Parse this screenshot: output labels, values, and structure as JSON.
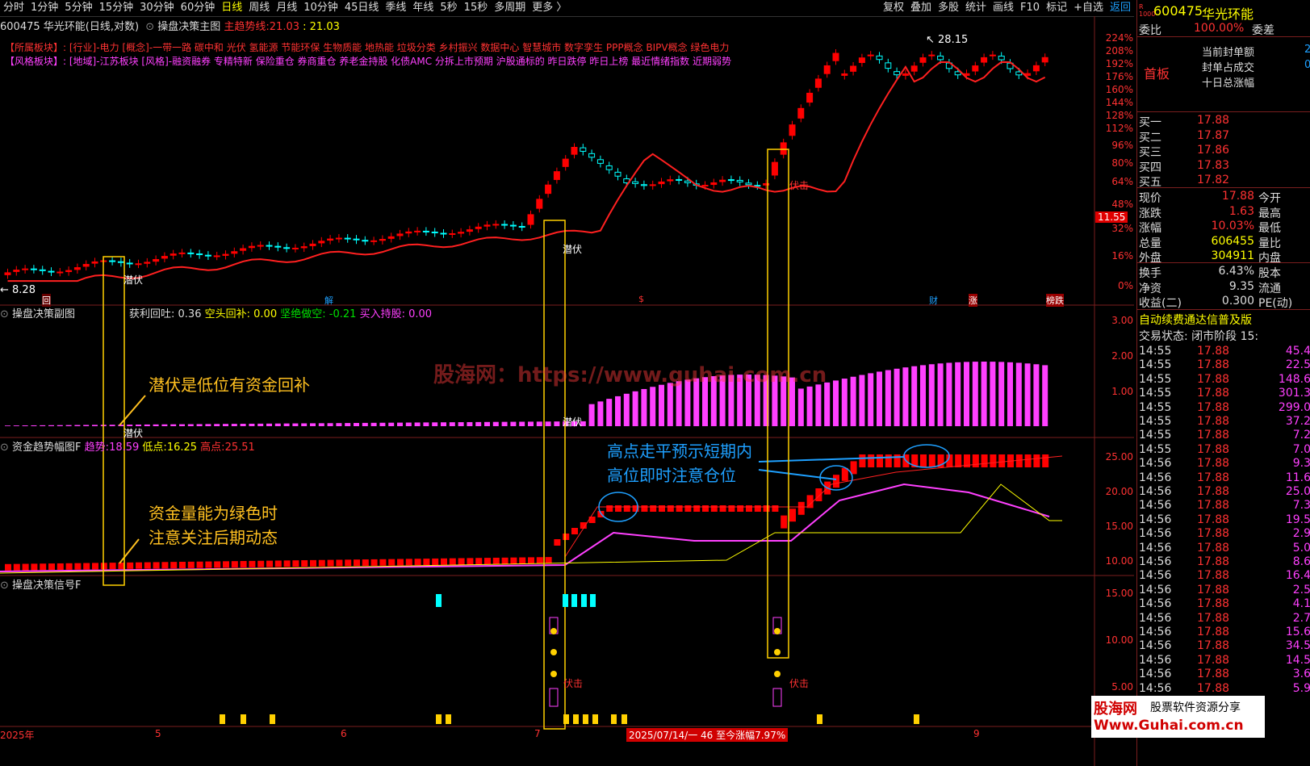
{
  "toolbar": {
    "periods": [
      "分时",
      "1分钟",
      "5分钟",
      "15分钟",
      "30分钟",
      "60分钟",
      "日线",
      "周线",
      "月线",
      "10分钟",
      "45日线",
      "季线",
      "年线",
      "5秒",
      "15秒",
      "多周期",
      "更多 〉"
    ],
    "active": "日线",
    "right_buttons": [
      "复权",
      "叠加",
      "多股",
      "统计",
      "画线",
      "F10",
      "标记",
      "+自选",
      "返回"
    ]
  },
  "main": {
    "title": "600475 华光环能(日线,对数)",
    "indicator_name": "操盘决策主图",
    "trend_label": "主趋势线:",
    "trend_v1": "21.03",
    "trend_v2": "21.03",
    "sector_line1_label": "【所属板块】:",
    "sector_line1": "[行业]-电力 [概念]-一带一路 碳中和 光伏 氢能源 节能环保 生物质能 地热能 垃圾分类 乡村振兴 数据中心 智慧城市 数字孪生 PPP概念 BIPV概念 绿色电力",
    "sector_line2_label": "【风格板块】:",
    "sector_line2": "[地域]-江苏板块 [风格]-融资融券 专精特新 保险重仓 券商重仓 养老金持股 化债AMC 分拆上市预期 沪股通标的 昨日跌停 昨日上榜 最近情绪指数 近期弱势",
    "high_label": "28.15",
    "low_label": "8.28",
    "price_tag": "11.55",
    "axis": [
      "224%",
      "208%",
      "192%",
      "176%",
      "160%",
      "144%",
      "128%",
      "112%",
      "96%",
      "80%",
      "64%",
      "48%",
      "32%",
      "16%",
      "0%"
    ],
    "signals": [
      "潜伏",
      "潜伏",
      "伏击"
    ],
    "event_marks": [
      "回",
      "解",
      "$",
      "财",
      "涨",
      "榜跌"
    ]
  },
  "sub1": {
    "name": "操盘决策副图",
    "v1_label": "获利回吐:",
    "v1": "0.36",
    "v2_label": "空头回补:",
    "v2": "0.00",
    "v3_label": "坚绝做空:",
    "v3": "-0.21",
    "v4_label": "买入持股:",
    "v4": "0.00",
    "axis": [
      "3.00",
      "2.00",
      "1.00"
    ],
    "watermark": "股海网：https://www.guhai.com.cn",
    "signal": "潜伏"
  },
  "sub2": {
    "name": "资金趋势幅图F",
    "v1_label": "趋势:",
    "v1": "18.59",
    "v2_label": "低点:",
    "v2": "16.25",
    "v3_label": "高点:",
    "v3": "25.51",
    "axis": [
      "25.00",
      "20.00",
      "15.00",
      "10.00"
    ]
  },
  "sub3": {
    "name": "操盘决策信号F",
    "axis": [
      "15.00",
      "10.00",
      "5.00"
    ],
    "signals": [
      "伏击",
      "伏击"
    ]
  },
  "annotations": {
    "a1": "潜伏是低位有资金回补",
    "a2a": "资金量能为绿色时",
    "a2b": "注意关注后期动态",
    "a3a": "高点走平预示短期内",
    "a3b": "高位即时注意仓位"
  },
  "dates": [
    "2025年",
    "5",
    "6",
    "7",
    "9"
  ],
  "date_highlight": "2025/07/14/一 46 至今涨幅7.97%",
  "right": {
    "code": "600475",
    "name": "华光环能",
    "weibi_label": "委比",
    "weibi": "100.00%",
    "weicha_label": "委差",
    "board_label": "首板",
    "seal1": "当前封单额",
    "seal2": "封单占成交",
    "seal3": "十日总涨幅",
    "seal_v1": "2",
    "seal_v2": "0",
    "bids": [
      {
        "l": "买一",
        "p": "17.88"
      },
      {
        "l": "买二",
        "p": "17.87"
      },
      {
        "l": "买三",
        "p": "17.86"
      },
      {
        "l": "买四",
        "p": "17.83"
      },
      {
        "l": "买五",
        "p": "17.82"
      }
    ],
    "quote": [
      {
        "l": "现价",
        "v": "17.88",
        "r": "今开"
      },
      {
        "l": "涨跌",
        "v": "1.63",
        "r": "最高"
      },
      {
        "l": "涨幅",
        "v": "10.03%",
        "r": "最低"
      },
      {
        "l": "总量",
        "v": "606455",
        "r": "量比"
      },
      {
        "l": "外盘",
        "v": "304911",
        "r": "内盘"
      }
    ],
    "stats": [
      {
        "l": "换手",
        "v": "6.43%",
        "r": "股本"
      },
      {
        "l": "净资",
        "v": "9.35",
        "r": "流通"
      },
      {
        "l": "收益(二)",
        "v": "0.300",
        "r": "PE(动)"
      }
    ],
    "notice": "自动续费通达信普及版",
    "state": "交易状态: 闭市阶段 15:",
    "ticks": [
      [
        "14:55",
        "17.88",
        "45.4"
      ],
      [
        "14:55",
        "17.88",
        "22.5"
      ],
      [
        "14:55",
        "17.88",
        "148.6"
      ],
      [
        "14:55",
        "17.88",
        "301.3"
      ],
      [
        "14:55",
        "17.88",
        "299.0"
      ],
      [
        "14:55",
        "17.88",
        "37.2"
      ],
      [
        "14:55",
        "17.88",
        "7.2"
      ],
      [
        "14:55",
        "17.88",
        "7.0"
      ],
      [
        "14:56",
        "17.88",
        "9.3"
      ],
      [
        "14:56",
        "17.88",
        "11.6"
      ],
      [
        "14:56",
        "17.88",
        "25.0"
      ],
      [
        "14:56",
        "17.88",
        "7.3"
      ],
      [
        "14:56",
        "17.88",
        "19.5"
      ],
      [
        "14:56",
        "17.88",
        "2.9"
      ],
      [
        "14:56",
        "17.88",
        "5.0"
      ],
      [
        "14:56",
        "17.88",
        "8.6"
      ],
      [
        "14:56",
        "17.88",
        "16.4"
      ],
      [
        "14:56",
        "17.88",
        "2.5"
      ],
      [
        "14:56",
        "17.88",
        "4.1"
      ],
      [
        "14:56",
        "17.88",
        "2.7"
      ],
      [
        "14:56",
        "17.88",
        "15.6"
      ],
      [
        "14:56",
        "17.88",
        "34.5"
      ],
      [
        "14:56",
        "17.88",
        "14.5"
      ],
      [
        "14:56",
        "17.88",
        "3.6"
      ],
      [
        "14:56",
        "17.88",
        "5.9"
      ]
    ]
  },
  "wm": {
    "t1": "股海网",
    "t2": "股票软件资源分享",
    "t3": "Www.Guhai.com.cn"
  },
  "colors": {
    "up": "#ff0000",
    "down": "#00ffff",
    "ma": "#ff2020",
    "magenta": "#ff40ff",
    "yellow": "#ffff00",
    "blue": "#1ea0ff"
  }
}
